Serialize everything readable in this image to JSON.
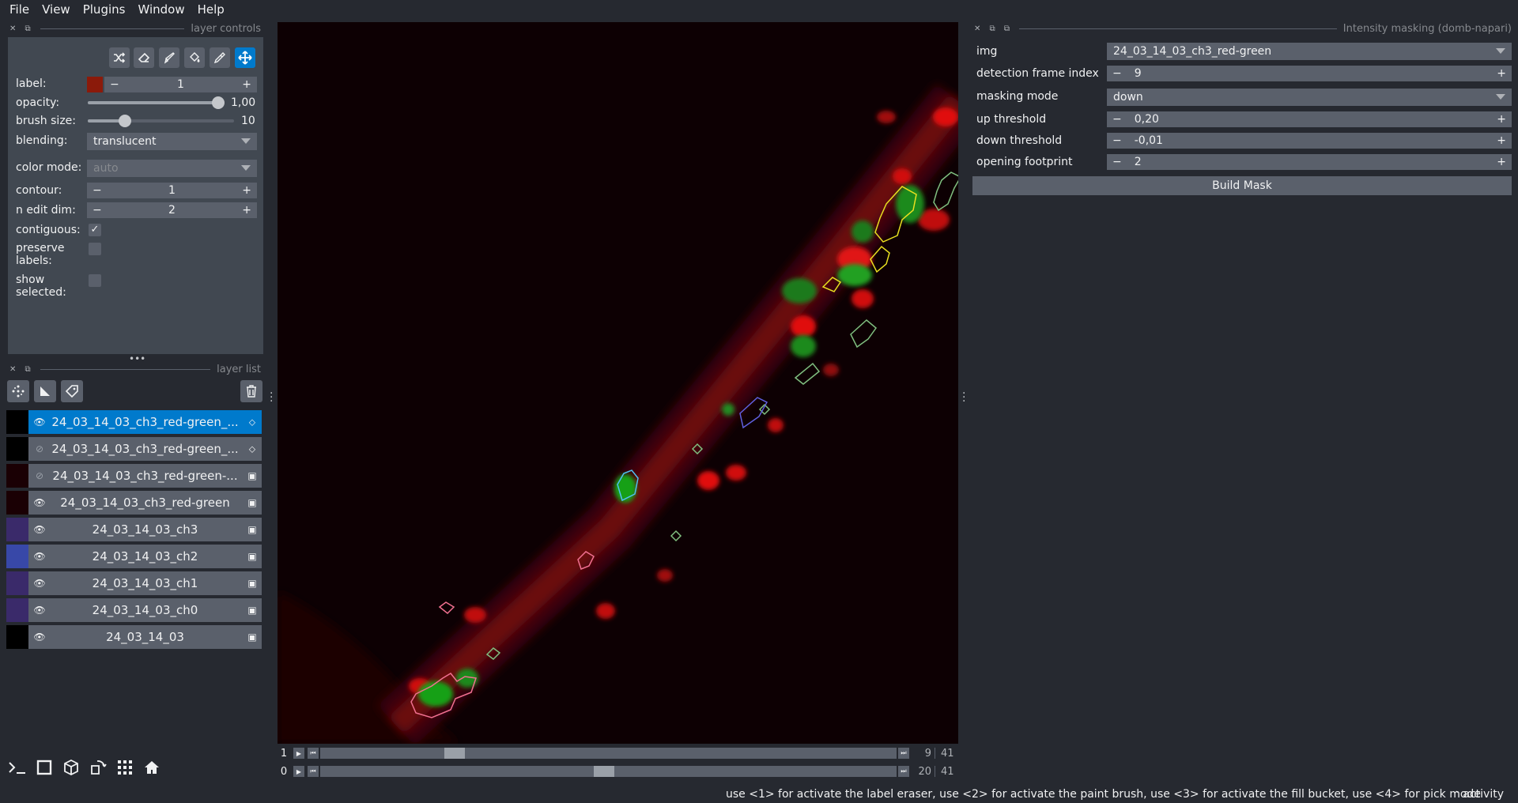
{
  "menubar": {
    "items": [
      "File",
      "View",
      "Plugins",
      "Window",
      "Help"
    ]
  },
  "layer_controls": {
    "title": "layer controls",
    "label_label": "label:",
    "label_value": "1",
    "label_color": "#8b1a0a",
    "opacity_label": "opacity:",
    "opacity_value": "1,00",
    "opacity_fraction": 1.0,
    "brush_size_label": "brush size:",
    "brush_size_value": "10",
    "blending_label": "blending:",
    "blending_value": "translucent",
    "color_mode_label": "color mode:",
    "color_mode_value": "auto",
    "contour_label": "contour:",
    "contour_value": "1",
    "n_edit_dim_label": "n edit dim:",
    "n_edit_dim_value": "2",
    "contiguous_label": "contiguous:",
    "preserve_labels_label1": "preserve",
    "preserve_labels_label2": "labels:",
    "show_selected_label1": "show",
    "show_selected_label2": "selected:"
  },
  "layer_list": {
    "title": "layer list",
    "layers": [
      {
        "name": "24_03_14_03_ch3_red-green_...",
        "type": "labels-icon",
        "visible": true
      },
      {
        "name": "24_03_14_03_ch3_red-green_...",
        "type": "labels-icon",
        "visible": false
      },
      {
        "name": "24_03_14_03_ch3_red-green-...",
        "type": "image-icon",
        "visible": false
      },
      {
        "name": "24_03_14_03_ch3_red-green",
        "type": "image-icon",
        "visible": true
      },
      {
        "name": "24_03_14_03_ch3",
        "type": "image-icon",
        "visible": true
      },
      {
        "name": "24_03_14_03_ch2",
        "type": "image-icon",
        "visible": true
      },
      {
        "name": "24_03_14_03_ch1",
        "type": "image-icon",
        "visible": true
      },
      {
        "name": "24_03_14_03_ch0",
        "type": "image-icon",
        "visible": true
      },
      {
        "name": "24_03_14_03",
        "type": "image-icon",
        "visible": true
      }
    ]
  },
  "dims": [
    {
      "axis": "1",
      "current": "9",
      "max": "41"
    },
    {
      "axis": "0",
      "current": "20",
      "max": "41"
    }
  ],
  "plugin": {
    "title": "Intensity masking (domb-napari)",
    "img_label": "img",
    "img_value": "24_03_14_03_ch3_red-green",
    "detection_frame_index_label": "detection frame index",
    "detection_frame_index_value": "9",
    "masking_mode_label": "masking mode",
    "masking_mode_value": "down",
    "up_threshold_label": "up threshold",
    "up_threshold_value": "0,20",
    "down_threshold_label": "down threshold",
    "down_threshold_value": "-0,01",
    "opening_footprint_label": "opening footprint",
    "opening_footprint_value": "2",
    "build_mask_label": "Build Mask"
  },
  "status": {
    "message": "use <1> for activate the label eraser, use <2> for activate the paint brush, use <3> for activate the fill bucket, use <4> for pick mode",
    "activity": "activity"
  },
  "colors": {
    "accent": "#007acc",
    "panel": "#414851",
    "background": "#262930"
  }
}
